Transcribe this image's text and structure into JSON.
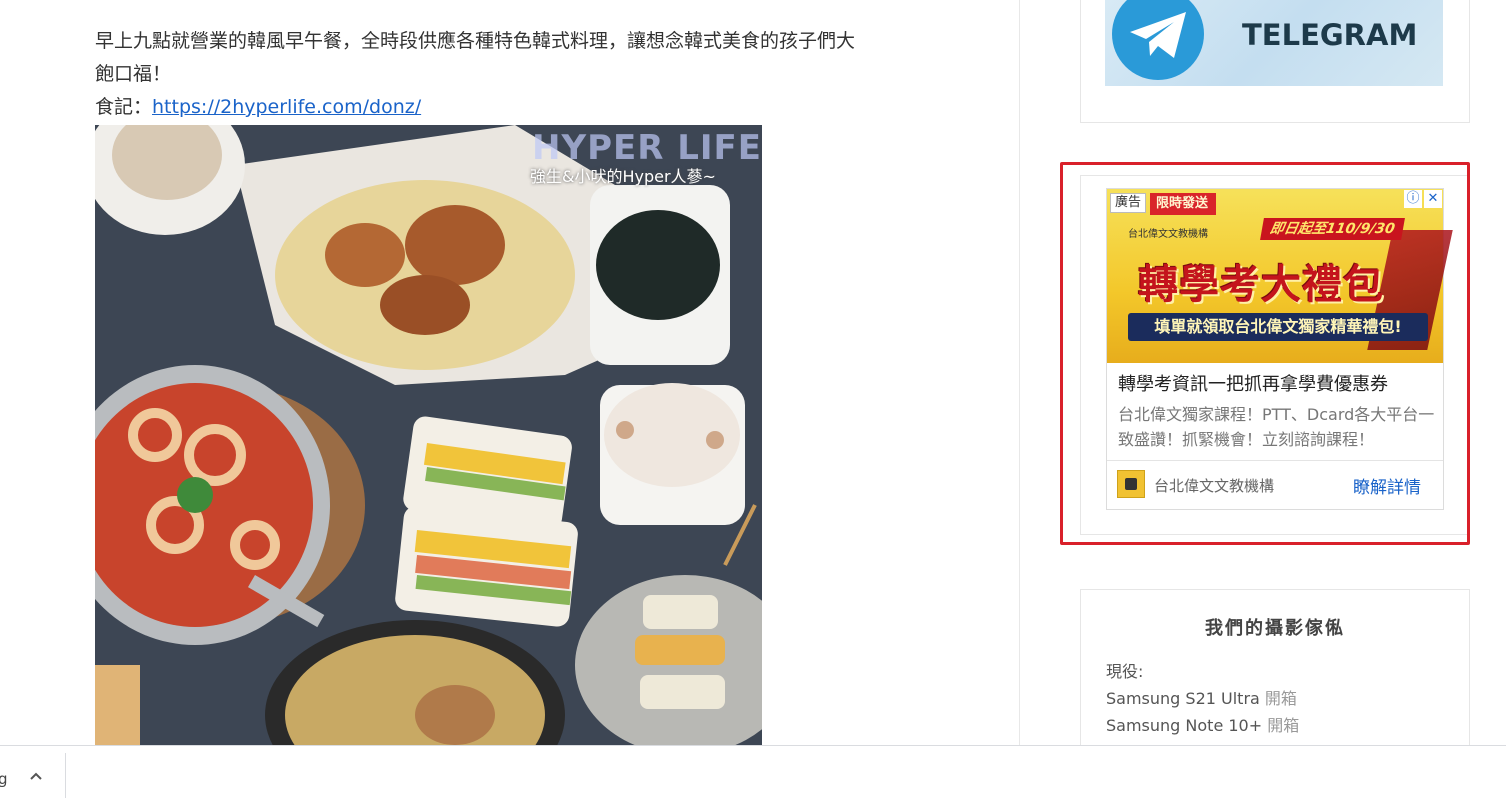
{
  "article": {
    "line1": "早上九點就營業的韓風早午餐，全時段供應各種特色韓式料理，讓想念韓式美食的孩子們大",
    "line2": "飽口福！",
    "food_note_label": "食記：",
    "food_note_link": "https://2hyperlife.com/donz/"
  },
  "photo": {
    "watermark_title": "HYPER LIFE",
    "watermark_sub": "強生&小吠的Hyper人蔘~"
  },
  "telegram": {
    "banner_text": "TELEGRAM"
  },
  "ad": {
    "label": "廣告",
    "corner_info": "ⓘ",
    "corner_close": "✕",
    "ribbon": "限時發送",
    "org_small": "台北偉文文教機構",
    "date_tag": "即日起至110/9/30",
    "headline": "轉學考大禮包",
    "strip": "填單就領取台北偉文獨家精華禮包!",
    "title": "轉學考資訊一把抓再拿學費優惠券",
    "description": "台北偉文獨家課程！PTT、Dcard各大平台一致盛讚！抓緊機會！立刻諮詢課程！",
    "advertiser": "台北偉文文教機構",
    "cta": "瞭解詳情",
    "colors": {
      "outline": "#d9202a",
      "cta": "#1a63c9"
    }
  },
  "photographers": {
    "title": "我們的攝影傢俬",
    "current_label": "現役:",
    "items": [
      {
        "device": "Samsung S21 Ultra",
        "tag": "開箱"
      },
      {
        "device": "Samsung Note 10+",
        "tag": "開箱"
      }
    ]
  },
  "download_bar": {
    "item_text": "g",
    "chevron_icon": "chevron-up-icon"
  }
}
